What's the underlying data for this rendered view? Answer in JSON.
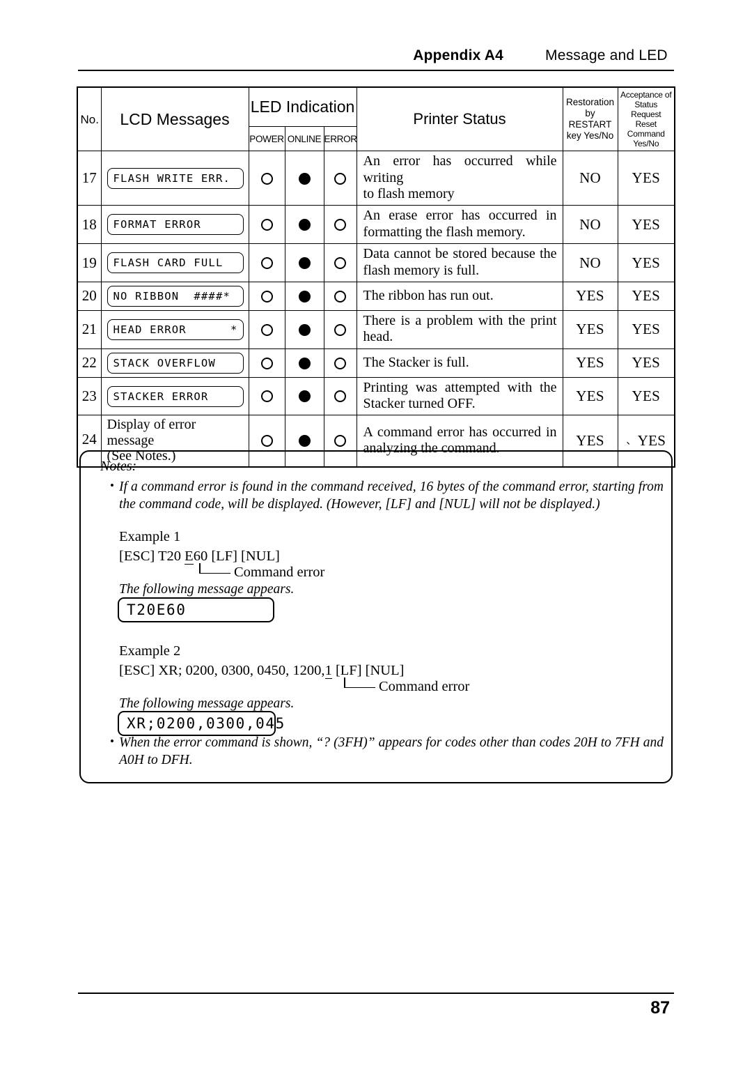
{
  "header": {
    "appendix": "Appendix A4",
    "subject": "Message and LED"
  },
  "table": {
    "columns": {
      "no": "No.",
      "lcd_messages": "LCD Messages",
      "led_indication": "LED Indication",
      "led_power": "POWER",
      "led_online": "ONLINE",
      "led_error": "ERROR",
      "printer_status": "Printer Status",
      "restoration_l1": "Restoration",
      "restoration_l2": "by RESTART",
      "restoration_l3": "key Yes/No",
      "acceptance_l1": "Acceptance of",
      "acceptance_l2": "Status Request",
      "acceptance_l3": "Reset Command",
      "acceptance_l4": "Yes/No"
    },
    "rows": [
      {
        "no": "17",
        "lcd": "FLASH WRITE ERR.",
        "lcd_style": "display",
        "power": "off",
        "online": "on",
        "error": "off",
        "status_line1": "An error has occurred while writing",
        "status_line2": "to flash memory",
        "status_justify": false,
        "restoration": "NO",
        "acceptance": "YES",
        "acceptance_artifact": ""
      },
      {
        "no": "18",
        "lcd": "FORMAT ERROR",
        "lcd_style": "display",
        "power": "off",
        "online": "on",
        "error": "off",
        "status_line1": "An erase error has occurred in",
        "status_line2": "formatting the flash memory.",
        "status_justify": true,
        "restoration": "NO",
        "acceptance": "YES",
        "acceptance_artifact": ""
      },
      {
        "no": "19",
        "lcd": "FLASH CARD FULL",
        "lcd_style": "display",
        "power": "off",
        "online": "on",
        "error": "off",
        "status_line1": "Data cannot be stored because the",
        "status_line2": "flash memory is full.",
        "status_justify": true,
        "restoration": "NO",
        "acceptance": "YES",
        "acceptance_artifact": ""
      },
      {
        "no": "20",
        "lcd": "NO RIBBON  ####*",
        "lcd_style": "display",
        "power": "off",
        "online": "on",
        "error": "off",
        "status_line1": "The ribbon has run out.",
        "status_line2": "",
        "status_justify": false,
        "restoration": "YES",
        "acceptance": "YES",
        "acceptance_artifact": ""
      },
      {
        "no": "21",
        "lcd": "HEAD ERROR      *",
        "lcd_style": "display",
        "power": "off",
        "online": "on",
        "error": "off",
        "status_line1": "There is a problem with the print",
        "status_line2": "head.",
        "status_justify": true,
        "restoration": "YES",
        "acceptance": "YES",
        "acceptance_artifact": ""
      },
      {
        "no": "22",
        "lcd": "STACK OVERFLOW",
        "lcd_style": "display",
        "power": "off",
        "online": "on",
        "error": "off",
        "status_line1": "The Stacker is full.",
        "status_line2": "",
        "status_justify": false,
        "restoration": "YES",
        "acceptance": "YES",
        "acceptance_artifact": ""
      },
      {
        "no": "23",
        "lcd": "STACKER ERROR",
        "lcd_style": "display",
        "power": "off",
        "online": "on",
        "error": "off",
        "status_line1": "Printing was attempted with the",
        "status_line2": "Stacker turned OFF.",
        "status_justify": true,
        "restoration": "YES",
        "acceptance": "YES",
        "acceptance_artifact": ""
      },
      {
        "no": "24",
        "lcd": "Display of error message\n(See Notes.)",
        "lcd_style": "plain",
        "lcd_plain_l1": "Display of error message",
        "lcd_plain_l2": "(See Notes.)",
        "power": "off",
        "online": "on",
        "error": "off",
        "status_line1": "A command error has occurred in",
        "status_line2": "analyzing the command.",
        "status_justify": true,
        "restoration": "YES",
        "acceptance": "YES",
        "acceptance_artifact": "、"
      }
    ]
  },
  "notes": {
    "title": "Notes:",
    "bullet_glyph": "•",
    "note1_line1": "If a command error is found in the command received, 16 bytes of the command error, starting from the",
    "note1_line2": "command code, will be displayed.  (However, [LF] and [NUL] will not be displayed.)",
    "note2_line1": "When the error command is shown, “? (3FH)” appears for codes other than codes 20H to 7FH and A0H to",
    "note2_line2": "DFH.",
    "example1": {
      "title": "Example 1",
      "command_prefix": "[ESC] T20 ",
      "command_marked": "E",
      "command_suffix": "60 [LF] [NUL]",
      "pointer_label": "Command error",
      "appears_text": "The following message appears.",
      "lcd_result": "T20E60"
    },
    "example2": {
      "title": "Example 2",
      "command_prefix": "[ESC] XR; 0200, 0300, 0450, 1200,",
      "command_marked": "1",
      "command_suffix": " [LF] [NUL]",
      "pointer_label": "Command error",
      "appears_text": "The following message appears.",
      "lcd_result": "XR;0200,0300,045"
    }
  },
  "footer": {
    "page_number": "87"
  }
}
